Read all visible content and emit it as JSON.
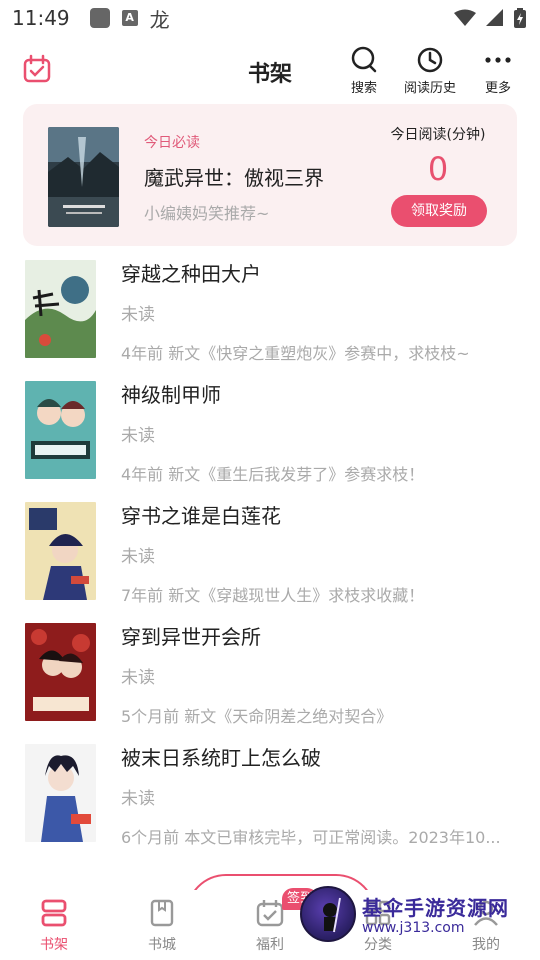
{
  "status_bar": {
    "time": "11:49",
    "icon_a": "A",
    "icon_glyph": "龙"
  },
  "header": {
    "title": "书架",
    "actions": [
      {
        "label": "搜索",
        "icon": "search-icon"
      },
      {
        "label": "阅读历史",
        "icon": "history-icon"
      },
      {
        "label": "更多",
        "icon": "more-icon"
      }
    ]
  },
  "daily": {
    "tag": "今日必读",
    "book_title": "魔武异世：傲视三界",
    "subtitle": "小编姨妈笑推荐~",
    "read_label": "今日阅读(分钟)",
    "read_minutes": "0",
    "claim_button": "领取奖励"
  },
  "books": [
    {
      "title": "穿越之种田大户",
      "status": "未读",
      "update": "4年前 新文《快穿之重塑炮灰》参赛中，求枝枝~"
    },
    {
      "title": "神级制甲师",
      "status": "未读",
      "update": "4年前 新文《重生后我发芽了》参赛求枝！"
    },
    {
      "title": "穿书之谁是白莲花",
      "status": "未读",
      "update": "7年前 新文《穿越现世人生》求枝求收藏！"
    },
    {
      "title": "穿到异世开会所",
      "status": "未读",
      "update": "5个月前 新文《天命阴差之绝对契合》"
    },
    {
      "title": "被末日系统盯上怎么破",
      "status": "未读",
      "update": "6个月前 本文已审核完毕，可正常阅读。2023年10..."
    }
  ],
  "nav": {
    "items": [
      {
        "label": "书架",
        "icon": "bookshelf-icon"
      },
      {
        "label": "书城",
        "icon": "bookstore-icon"
      },
      {
        "label": "福利",
        "icon": "welfare-icon"
      },
      {
        "label": "分类",
        "icon": "category-icon"
      },
      {
        "label": "我的",
        "icon": "profile-icon"
      }
    ],
    "sign_badge": "签到"
  },
  "watermark": {
    "title": "基伞手游资源网",
    "url": "www.j313.com"
  },
  "colors": {
    "accent": "#ea4f6f",
    "card_bg": "#fbf0f1",
    "muted": "#aaaaaa"
  }
}
